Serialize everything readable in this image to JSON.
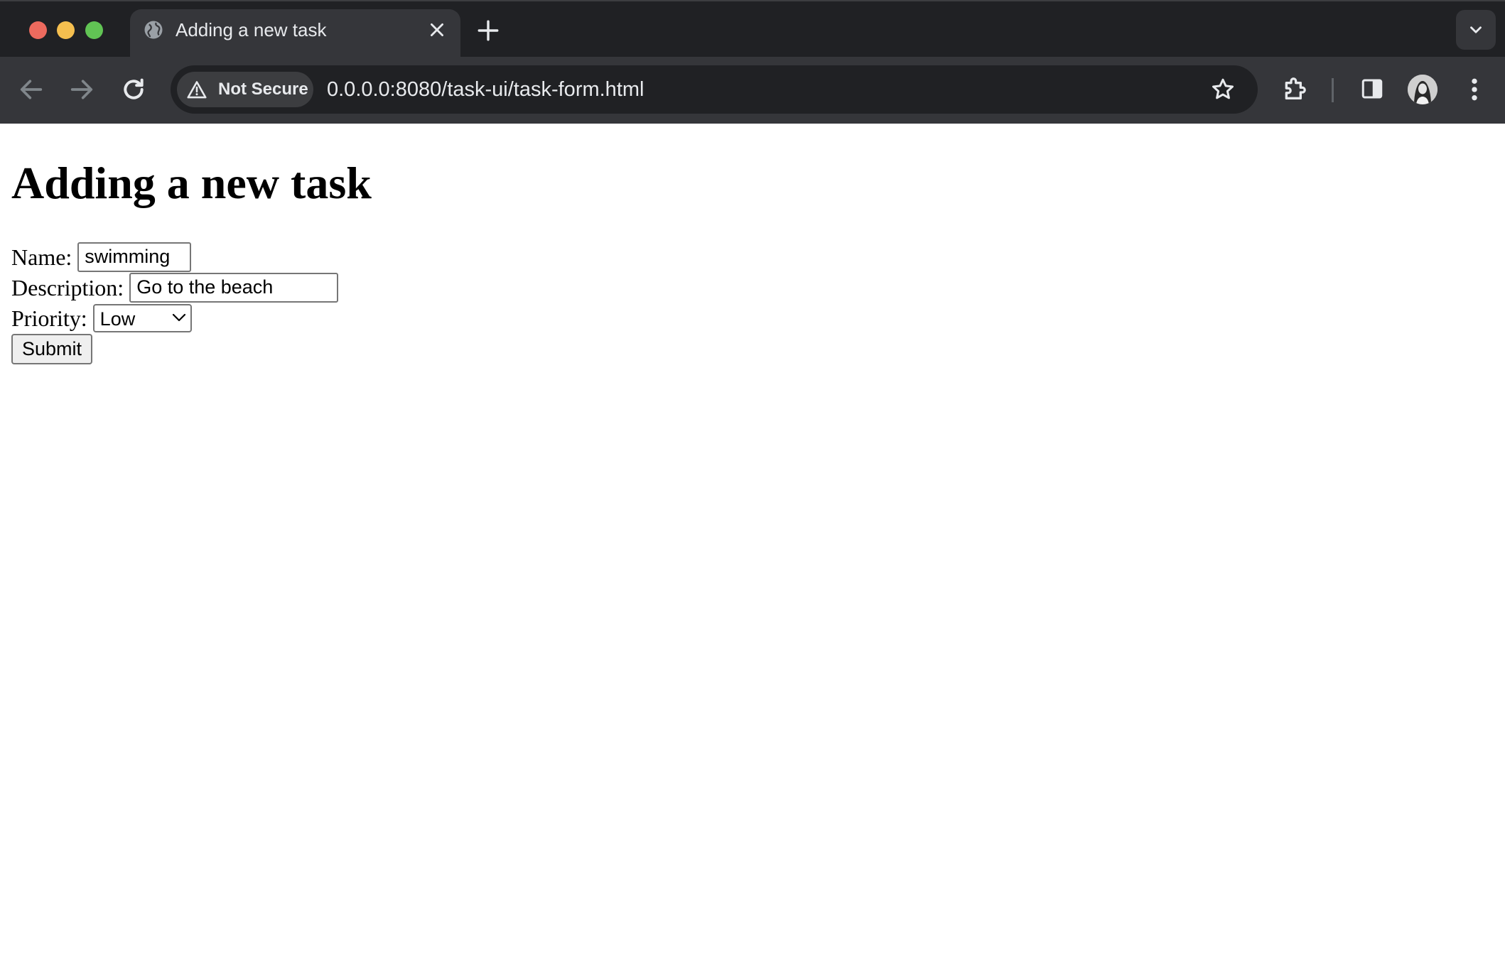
{
  "window": {
    "tab_title": "Adding a new task",
    "security_label": "Not Secure",
    "url": "0.0.0.0:8080/task-ui/task-form.html"
  },
  "icons": {
    "tab_favicon": "globe-icon",
    "tab_close": "close-icon",
    "new_tab": "plus-icon",
    "tab_search": "chevron-down-icon",
    "back": "arrow-left-icon",
    "forward": "arrow-right-icon",
    "reload": "reload-icon",
    "security": "warning-triangle-icon",
    "bookmark": "star-icon",
    "extensions": "puzzle-icon",
    "side_panel": "side-panel-icon",
    "profile": "avatar",
    "menu": "kebab-menu-icon"
  },
  "page": {
    "title": "Adding a new task",
    "form": {
      "name_label": "Name:",
      "name_value": "swimming",
      "description_label": "Description:",
      "description_value": "Go to the beach",
      "priority_label": "Priority:",
      "priority_value": "Low",
      "submit_label": "Submit"
    }
  },
  "colors": {
    "chrome_dark": "#202124",
    "chrome_toolbar": "#35363a",
    "chrome_text": "#e8eaed",
    "close_red": "#ed6a5e",
    "minimize_yellow": "#f5bf4f",
    "maximize_green": "#61c454"
  }
}
